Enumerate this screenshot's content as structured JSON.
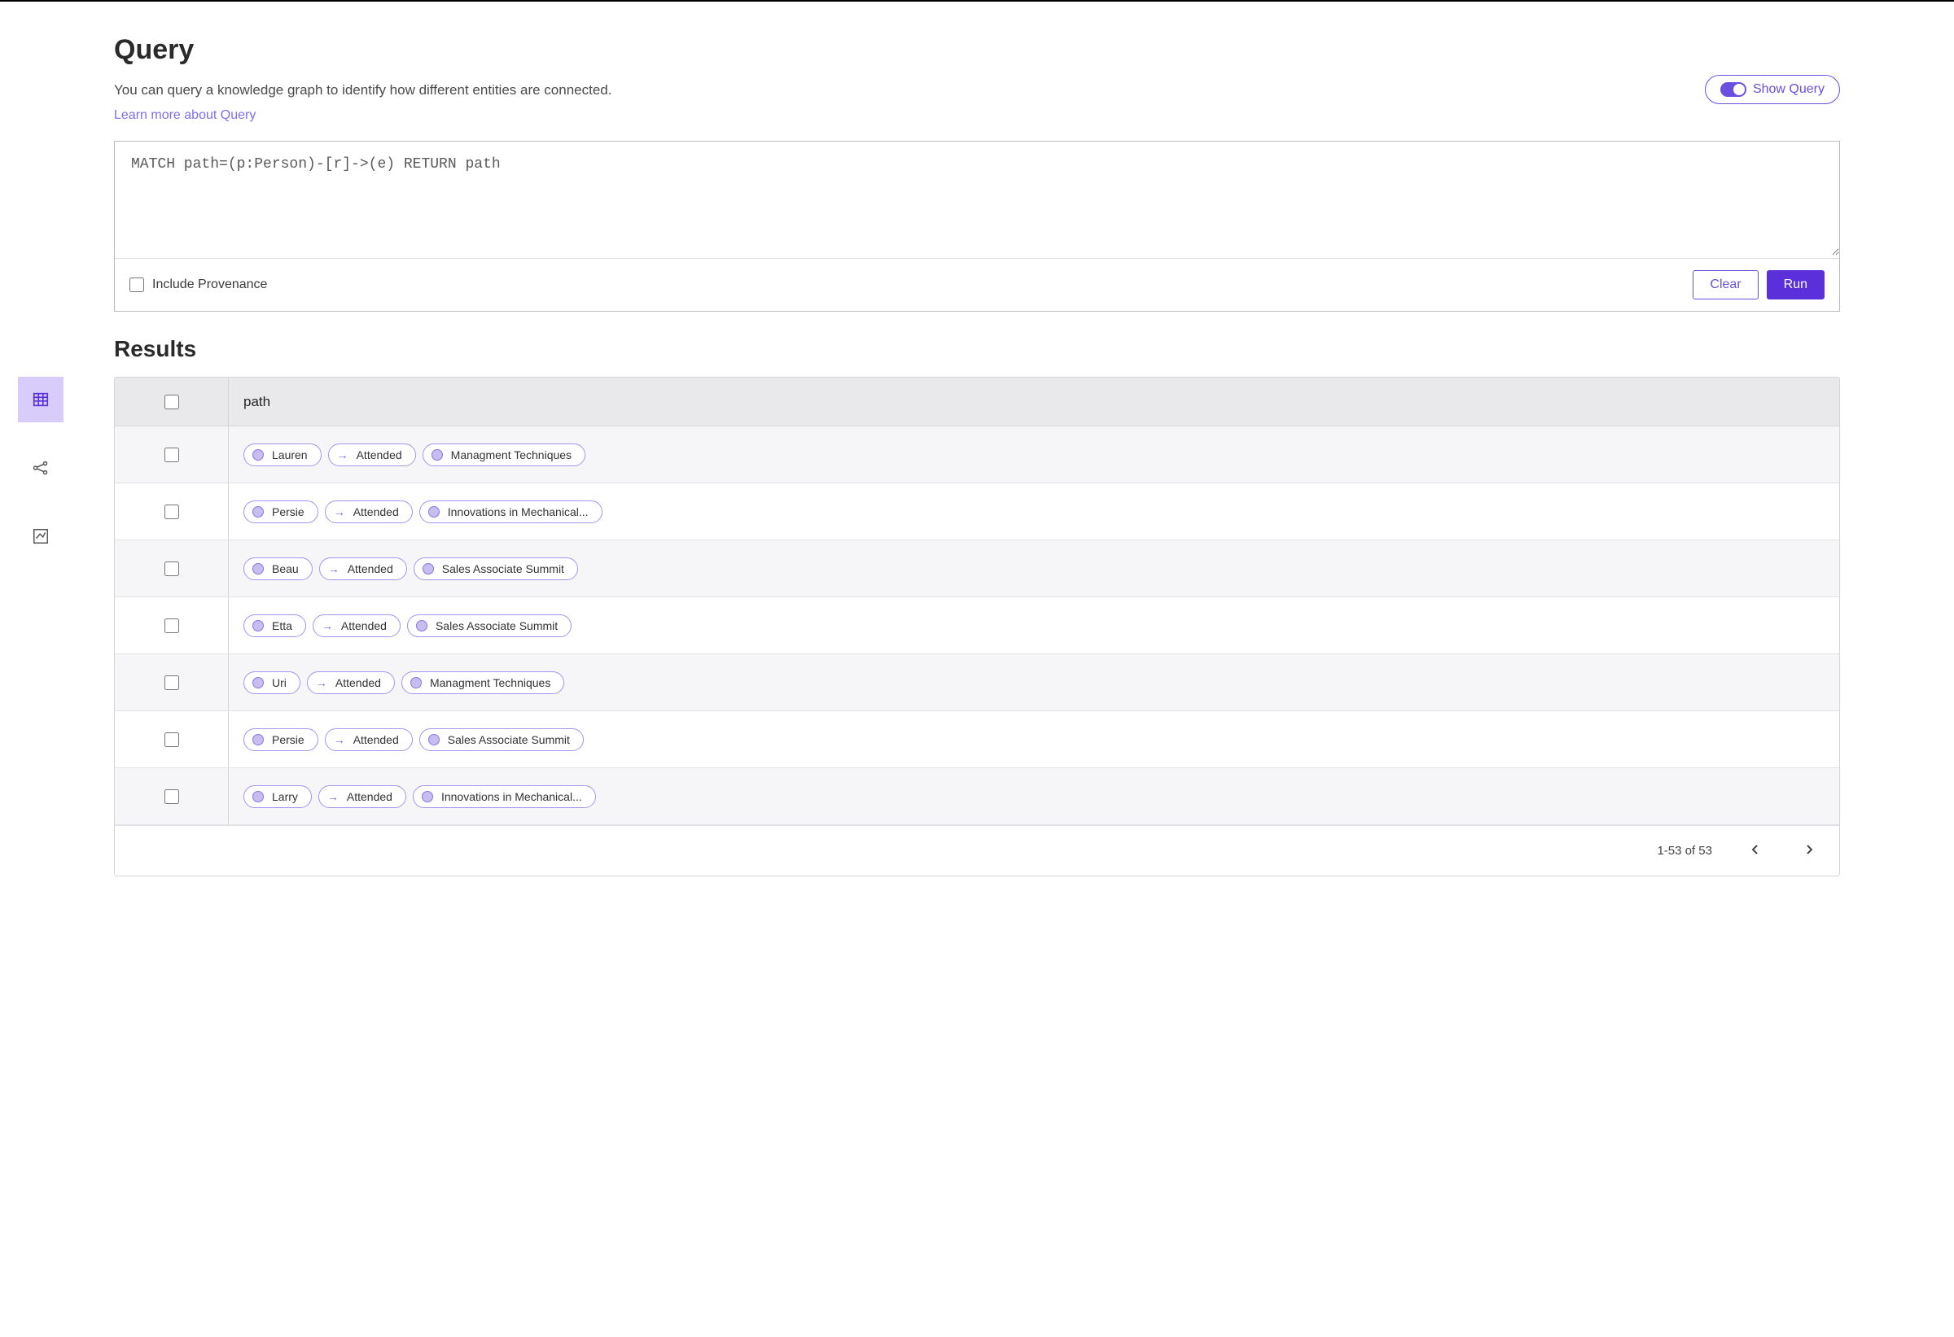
{
  "header": {
    "title": "Query",
    "description": "You can query a knowledge graph to identify how different entities are connected.",
    "learn_more": "Learn more about Query",
    "show_query_label": "Show Query"
  },
  "query": {
    "value": "MATCH path=(p:Person)-[r]->(e) RETURN path",
    "include_provenance_label": "Include Provenance",
    "clear_label": "Clear",
    "run_label": "Run"
  },
  "results": {
    "title": "Results",
    "column_header": "path",
    "pagination": "1-53 of 53",
    "rows": [
      {
        "person": "Lauren",
        "rel": "Attended",
        "event": "Managment Techniques"
      },
      {
        "person": "Persie",
        "rel": "Attended",
        "event": "Innovations in Mechanical..."
      },
      {
        "person": "Beau",
        "rel": "Attended",
        "event": "Sales Associate Summit"
      },
      {
        "person": "Etta",
        "rel": "Attended",
        "event": "Sales Associate Summit"
      },
      {
        "person": "Uri",
        "rel": "Attended",
        "event": "Managment Techniques"
      },
      {
        "person": "Persie",
        "rel": "Attended",
        "event": "Sales Associate Summit"
      },
      {
        "person": "Larry",
        "rel": "Attended",
        "event": "Innovations in Mechanical..."
      }
    ]
  },
  "view_rail": {
    "table_icon": "table",
    "graph_icon": "graph",
    "chart_icon": "chart"
  }
}
